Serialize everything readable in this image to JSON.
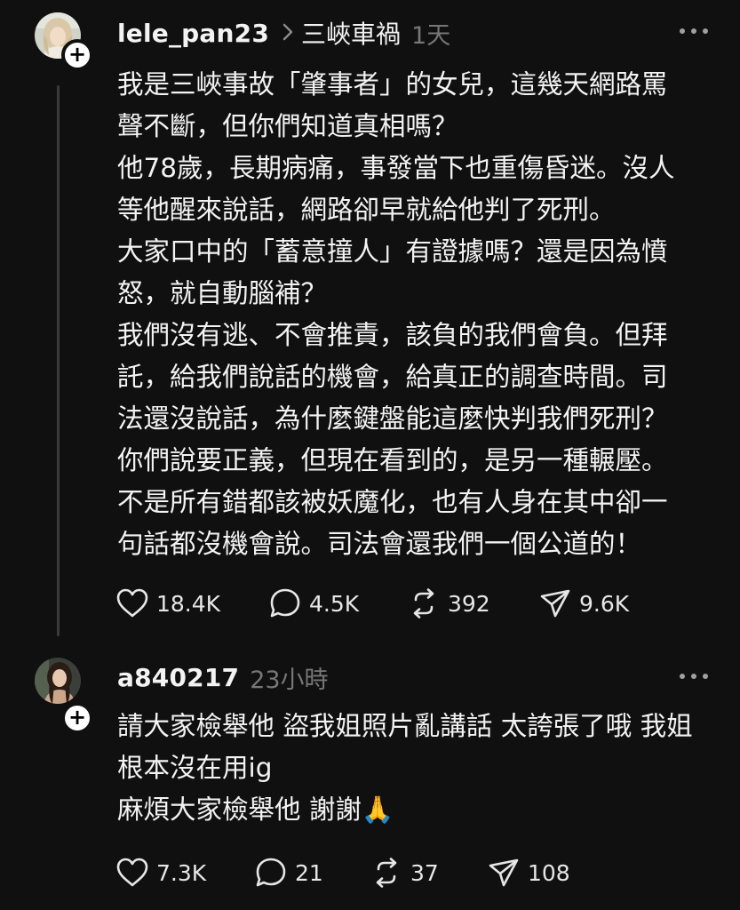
{
  "posts": [
    {
      "username": "lele_pan23",
      "topic": "三峽車禍",
      "time": "1天",
      "follow_symbol": "+",
      "avatar_icon": "profile-photo-blonde-woman",
      "body": "我是三峽事故「肇事者」的女兒，這幾天網路罵\n聲不斷，但你們知道真相嗎？\n他78歲，長期病痛，事發當下也重傷昏迷。沒人\n等他醒來說話，網路卻早就給他判了死刑。\n大家口中的「蓄意撞人」有證據嗎？還是因為憤\n怒，就自動腦補？\n我們沒有逃、不會推責，該負的我們會負。但拜\n託，給我們說話的機會，給真正的調查時間。司\n法還沒說話，為什麼鍵盤能這麼快判我們死刑？\n你們說要正義，但現在看到的，是另一種輾壓。\n不是所有錯都該被妖魔化，也有人身在其中卻一\n句話都沒機會說。司法會還我們一個公道的！",
      "likes": "18.4K",
      "replies": "4.5K",
      "reposts": "392",
      "shares": "9.6K"
    },
    {
      "username": "a840217",
      "time": "23小時",
      "follow_symbol": "+",
      "avatar_icon": "profile-photo-dark-haired-woman",
      "body": "請大家檢舉他 盜我姐照片亂講話 太誇張了哦 我姐\n根本沒在用ig\n麻煩大家檢舉他 謝謝🙏",
      "likes": "7.3K",
      "replies": "21",
      "reposts": "37",
      "shares": "108"
    }
  ],
  "colors": {
    "background": "#101010",
    "text": "#f3f3f3",
    "muted": "#777777",
    "thread_line": "#3a3a3a"
  },
  "icons": [
    "heart-icon",
    "comment-icon",
    "repost-icon",
    "share-icon",
    "more-icon",
    "chevron-right-icon",
    "follow-plus-icon"
  ]
}
